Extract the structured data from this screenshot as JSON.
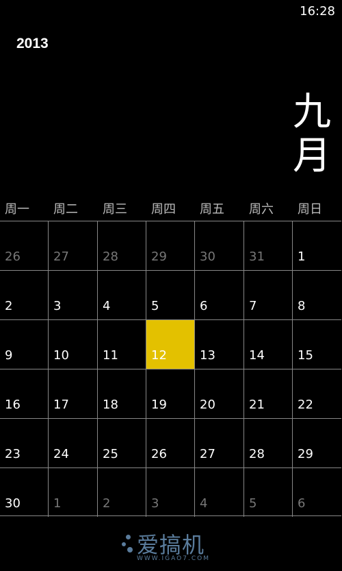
{
  "status_bar": {
    "time": "16:28"
  },
  "header": {
    "year": "2013",
    "month_chars": [
      "九",
      "月"
    ]
  },
  "weekdays": [
    "周一",
    "周二",
    "周三",
    "周四",
    "周五",
    "周六",
    "周日"
  ],
  "weeks": [
    [
      {
        "d": "26",
        "dim": true
      },
      {
        "d": "27",
        "dim": true
      },
      {
        "d": "28",
        "dim": true
      },
      {
        "d": "29",
        "dim": true
      },
      {
        "d": "30",
        "dim": true
      },
      {
        "d": "31",
        "dim": true
      },
      {
        "d": "1"
      }
    ],
    [
      {
        "d": "2"
      },
      {
        "d": "3"
      },
      {
        "d": "4"
      },
      {
        "d": "5"
      },
      {
        "d": "6"
      },
      {
        "d": "7"
      },
      {
        "d": "8"
      }
    ],
    [
      {
        "d": "9"
      },
      {
        "d": "10"
      },
      {
        "d": "11"
      },
      {
        "d": "12",
        "today": true
      },
      {
        "d": "13"
      },
      {
        "d": "14"
      },
      {
        "d": "15"
      }
    ],
    [
      {
        "d": "16"
      },
      {
        "d": "17"
      },
      {
        "d": "18"
      },
      {
        "d": "19"
      },
      {
        "d": "20"
      },
      {
        "d": "21"
      },
      {
        "d": "22"
      }
    ],
    [
      {
        "d": "23"
      },
      {
        "d": "24"
      },
      {
        "d": "25"
      },
      {
        "d": "26"
      },
      {
        "d": "27"
      },
      {
        "d": "28"
      },
      {
        "d": "29"
      }
    ],
    [
      {
        "d": "30"
      },
      {
        "d": "1",
        "dim": true
      },
      {
        "d": "2",
        "dim": true
      },
      {
        "d": "3",
        "dim": true
      },
      {
        "d": "4",
        "dim": true
      },
      {
        "d": "5",
        "dim": true
      },
      {
        "d": "6",
        "dim": true
      }
    ]
  ],
  "colors": {
    "today": "#e3c100",
    "dim_text": "#777777",
    "grid_line": "#888888"
  },
  "watermark": {
    "text": "爱搞机",
    "url": "WWW.IGAO7.COM"
  }
}
